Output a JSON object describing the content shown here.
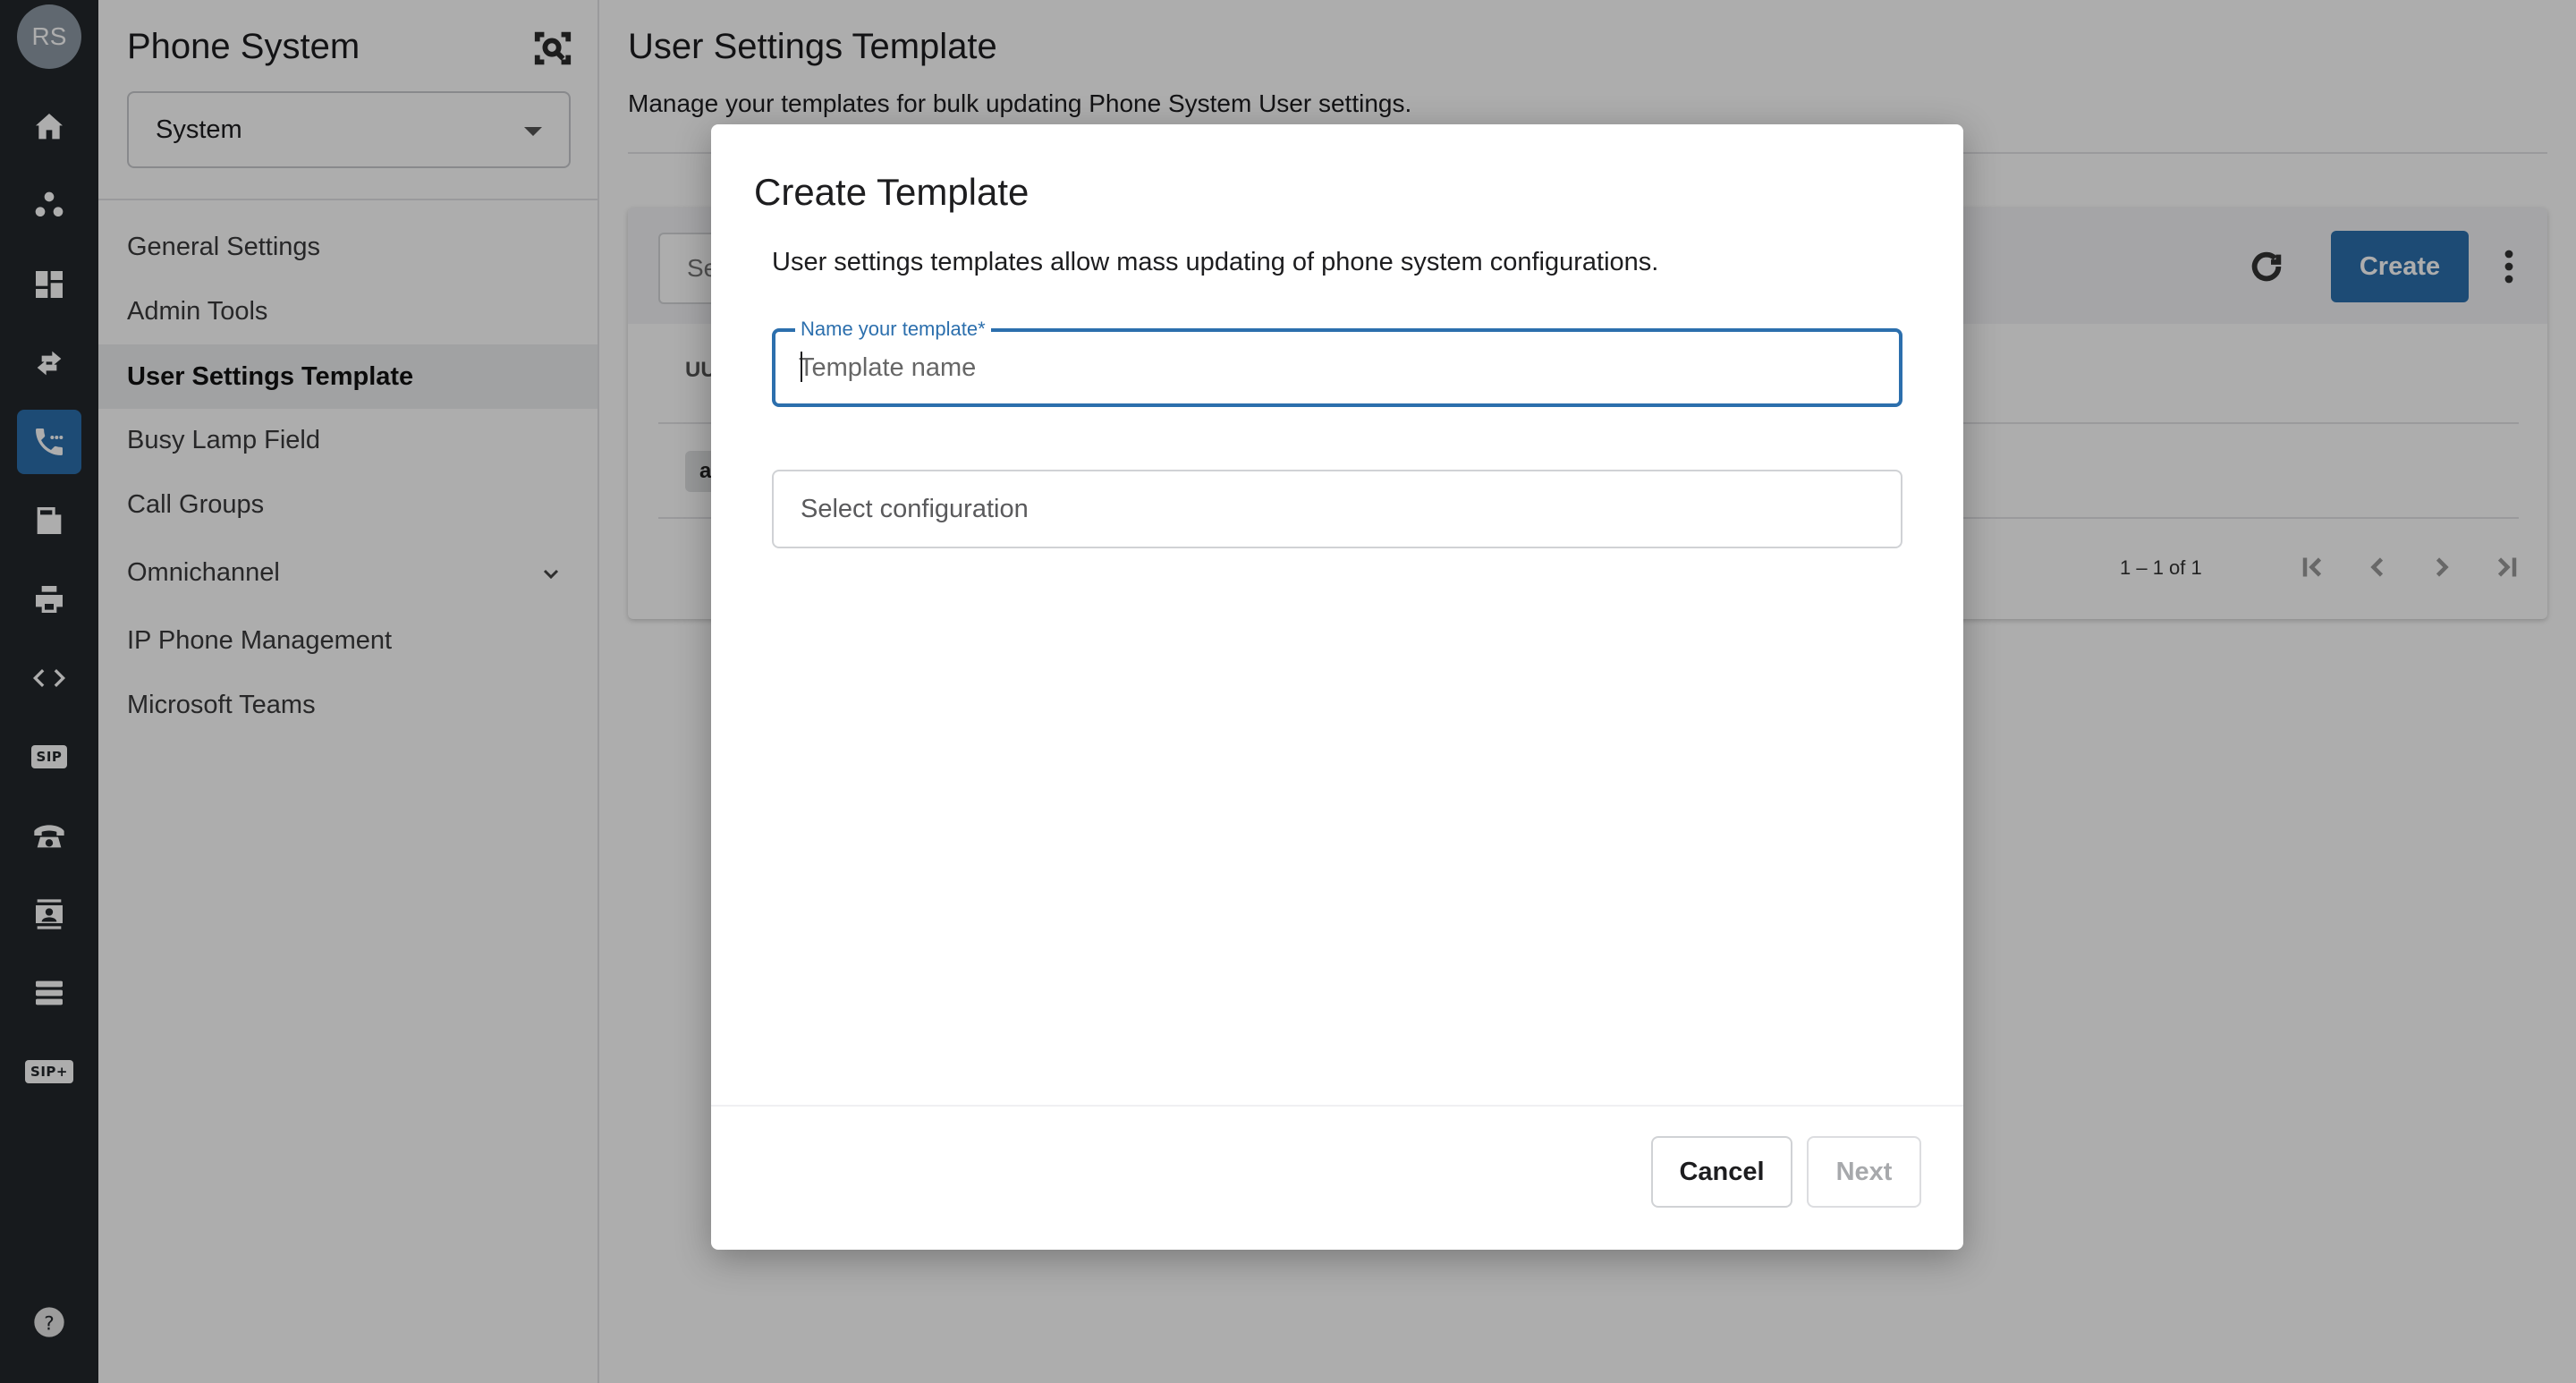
{
  "user": {
    "initials": "RS"
  },
  "rail": {
    "items": [
      {
        "icon": "home-icon"
      },
      {
        "icon": "users-group-icon"
      },
      {
        "icon": "dashboard-icon"
      },
      {
        "icon": "transfer-arrows-icon"
      },
      {
        "icon": "phone-active-icon",
        "active": true
      },
      {
        "icon": "fax-icon"
      },
      {
        "icon": "printer-icon"
      },
      {
        "icon": "code-icon"
      },
      {
        "icon": "sip-icon",
        "text": "SIP"
      },
      {
        "icon": "desk-phone-icon"
      },
      {
        "icon": "contact-card-icon"
      },
      {
        "icon": "server-list-icon"
      },
      {
        "icon": "sip-plus-icon",
        "text": "SIP+"
      }
    ],
    "help_icon": "help-icon"
  },
  "sidebar": {
    "title": "Phone System",
    "selector": {
      "value": "System"
    },
    "items": [
      {
        "label": "General Settings"
      },
      {
        "label": "Admin Tools"
      },
      {
        "label": "User Settings Template",
        "active": true
      },
      {
        "label": "Busy Lamp Field"
      },
      {
        "label": "Call Groups"
      },
      {
        "label": "Omnichannel",
        "expandable": true
      },
      {
        "label": "IP Phone Management"
      },
      {
        "label": "Microsoft Teams"
      }
    ]
  },
  "main": {
    "title": "User Settings Template",
    "subtitle": "Manage your templates for bulk updating Phone System User settings.",
    "toolbar": {
      "search_placeholder_visible": "Se",
      "create_label": "Create"
    },
    "table": {
      "column_visible": "UU",
      "row_chip_visible": "a",
      "pagination": "1 – 1 of 1"
    }
  },
  "modal": {
    "title": "Create Template",
    "description": "User settings templates allow mass updating of phone system configurations.",
    "name_field": {
      "label": "Name your template*",
      "placeholder": "Template name",
      "value": ""
    },
    "config_field": {
      "placeholder": "Select configuration"
    },
    "cancel_label": "Cancel",
    "next_label": "Next"
  },
  "colors": {
    "accent": "#2c6fad",
    "rail_bg": "#23272b"
  }
}
